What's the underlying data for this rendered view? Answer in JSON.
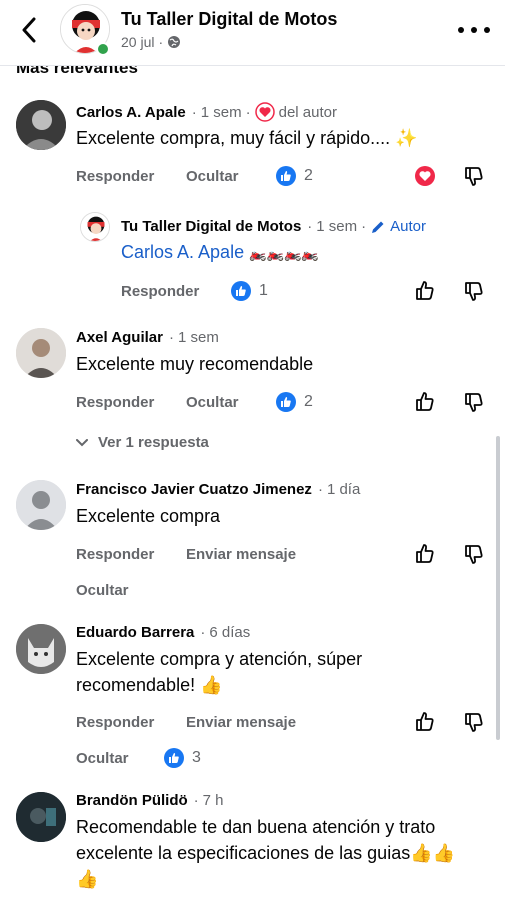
{
  "header": {
    "title": "Tu Taller Digital de Motos",
    "date": "20 jul",
    "section_label": "Más relevantes"
  },
  "actions": {
    "reply": "Responder",
    "hide": "Ocultar",
    "send_message": "Enviar mensaje"
  },
  "comments": [
    {
      "name": "Carlos A. Apale",
      "time": "1 sem",
      "author_badge": "del autor",
      "text": "Excelente compra, muy fácil y rápido.... ✨",
      "likes": "2",
      "reply": {
        "name": "Tu Taller Digital de Motos",
        "time": "1 sem",
        "badge": "Autor",
        "mention": "Carlos A. Apale",
        "text": "🏍️🏍️🏍️🏍️",
        "likes": "1"
      }
    },
    {
      "name": "Axel Aguilar",
      "time": "1 sem",
      "text": "Excelente muy recomendable",
      "likes": "2",
      "view_replies": "Ver 1 respuesta"
    },
    {
      "name": "Francisco Javier Cuatzo Jimenez",
      "time": "1 día",
      "text": "Excelente compra"
    },
    {
      "name": "Eduardo Barrera",
      "time": "6 días",
      "text_line1": "Excelente compra y atención, súper",
      "text_line2": "recomendable! 👍",
      "likes": "3"
    },
    {
      "name": "Brandön Pülidö",
      "time": "7 h",
      "text_line1": "Recomendable te dan buena atención y trato",
      "text_line2": "excelente la especificaciones de las guias👍👍",
      "text_line3": "👍"
    }
  ],
  "colors": {
    "like_blue": "#1877f2",
    "heart_red": "#f02849",
    "online_green": "#31a24c",
    "author_blue": "#1a5fc9"
  }
}
